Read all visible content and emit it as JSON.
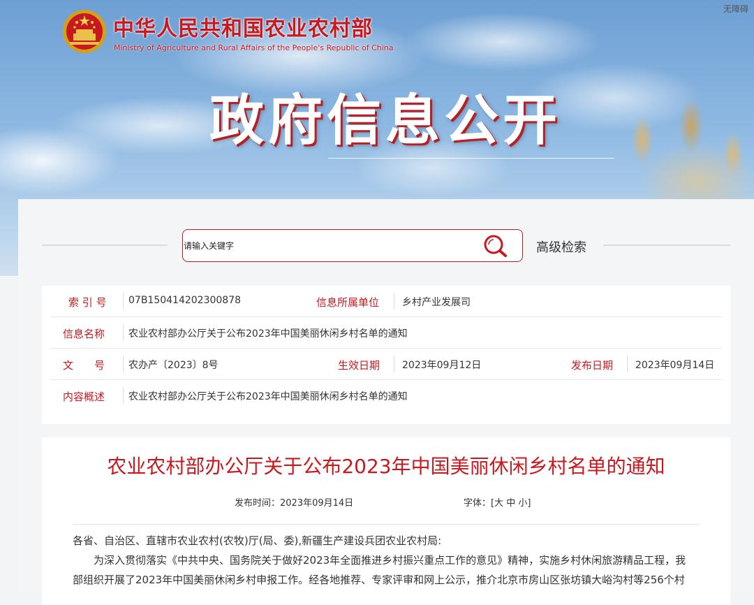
{
  "header": {
    "accessibility_link": "无障碍",
    "ministry_cn": "中华人民共和国农业农村部",
    "ministry_en": "Ministry of Agriculture and Rural Affairs of the People's Republic of China",
    "banner_title": "政府信息公开"
  },
  "search": {
    "placeholder": "请输入关键字",
    "advanced_label": "高级检索",
    "icon": "search-icon"
  },
  "info": {
    "index_label": "索 引 号",
    "index_value": "07B150414202300878",
    "unit_label": "信息所属单位",
    "unit_value": "乡村产业发展司",
    "name_label": "信息名称",
    "name_value": "农业农村部办公厅关于公布2023年中国美丽休闲乡村名单的通知",
    "doc_label": "文　　号",
    "doc_value": "农办产〔2023〕8号",
    "effective_label": "生效日期",
    "effective_value": "2023年09月12日",
    "publish_label": "发布日期",
    "publish_value": "2023年09月14日",
    "summary_label": "内容概述",
    "summary_value": "农业农村部办公厅关于公布2023年中国美丽休闲乡村名单的通知"
  },
  "article": {
    "title": "农业农村部办公厅关于公布2023年中国美丽休闲乡村名单的通知",
    "publish_time_label": "发布时间：",
    "publish_time_value": "2023年09月14日",
    "font_size_label": "字体：",
    "font_open": "[",
    "font_large": "大",
    "font_medium": "中",
    "font_small": "小",
    "font_close": "]",
    "salutation": "各省、自治区、直辖市农业农村(农牧)厅(局、委),新疆生产建设兵团农业农村局:",
    "para1_line1": "为深入贯彻落实《中共中央、国务院关于做好2023年全面推进乡村振兴重点工作的意见》精神，实施乡村休闲旅游精品工程，我",
    "para1_line2": "部组织开展了2023年中国美丽休闲乡村申报工作。经各地推荐、专家评审和网上公示，推介北京市房山区张坊镇大峪沟村等256个村"
  },
  "colors": {
    "brand_red": "#c8191f",
    "sky_blue": "#8db8e2"
  }
}
